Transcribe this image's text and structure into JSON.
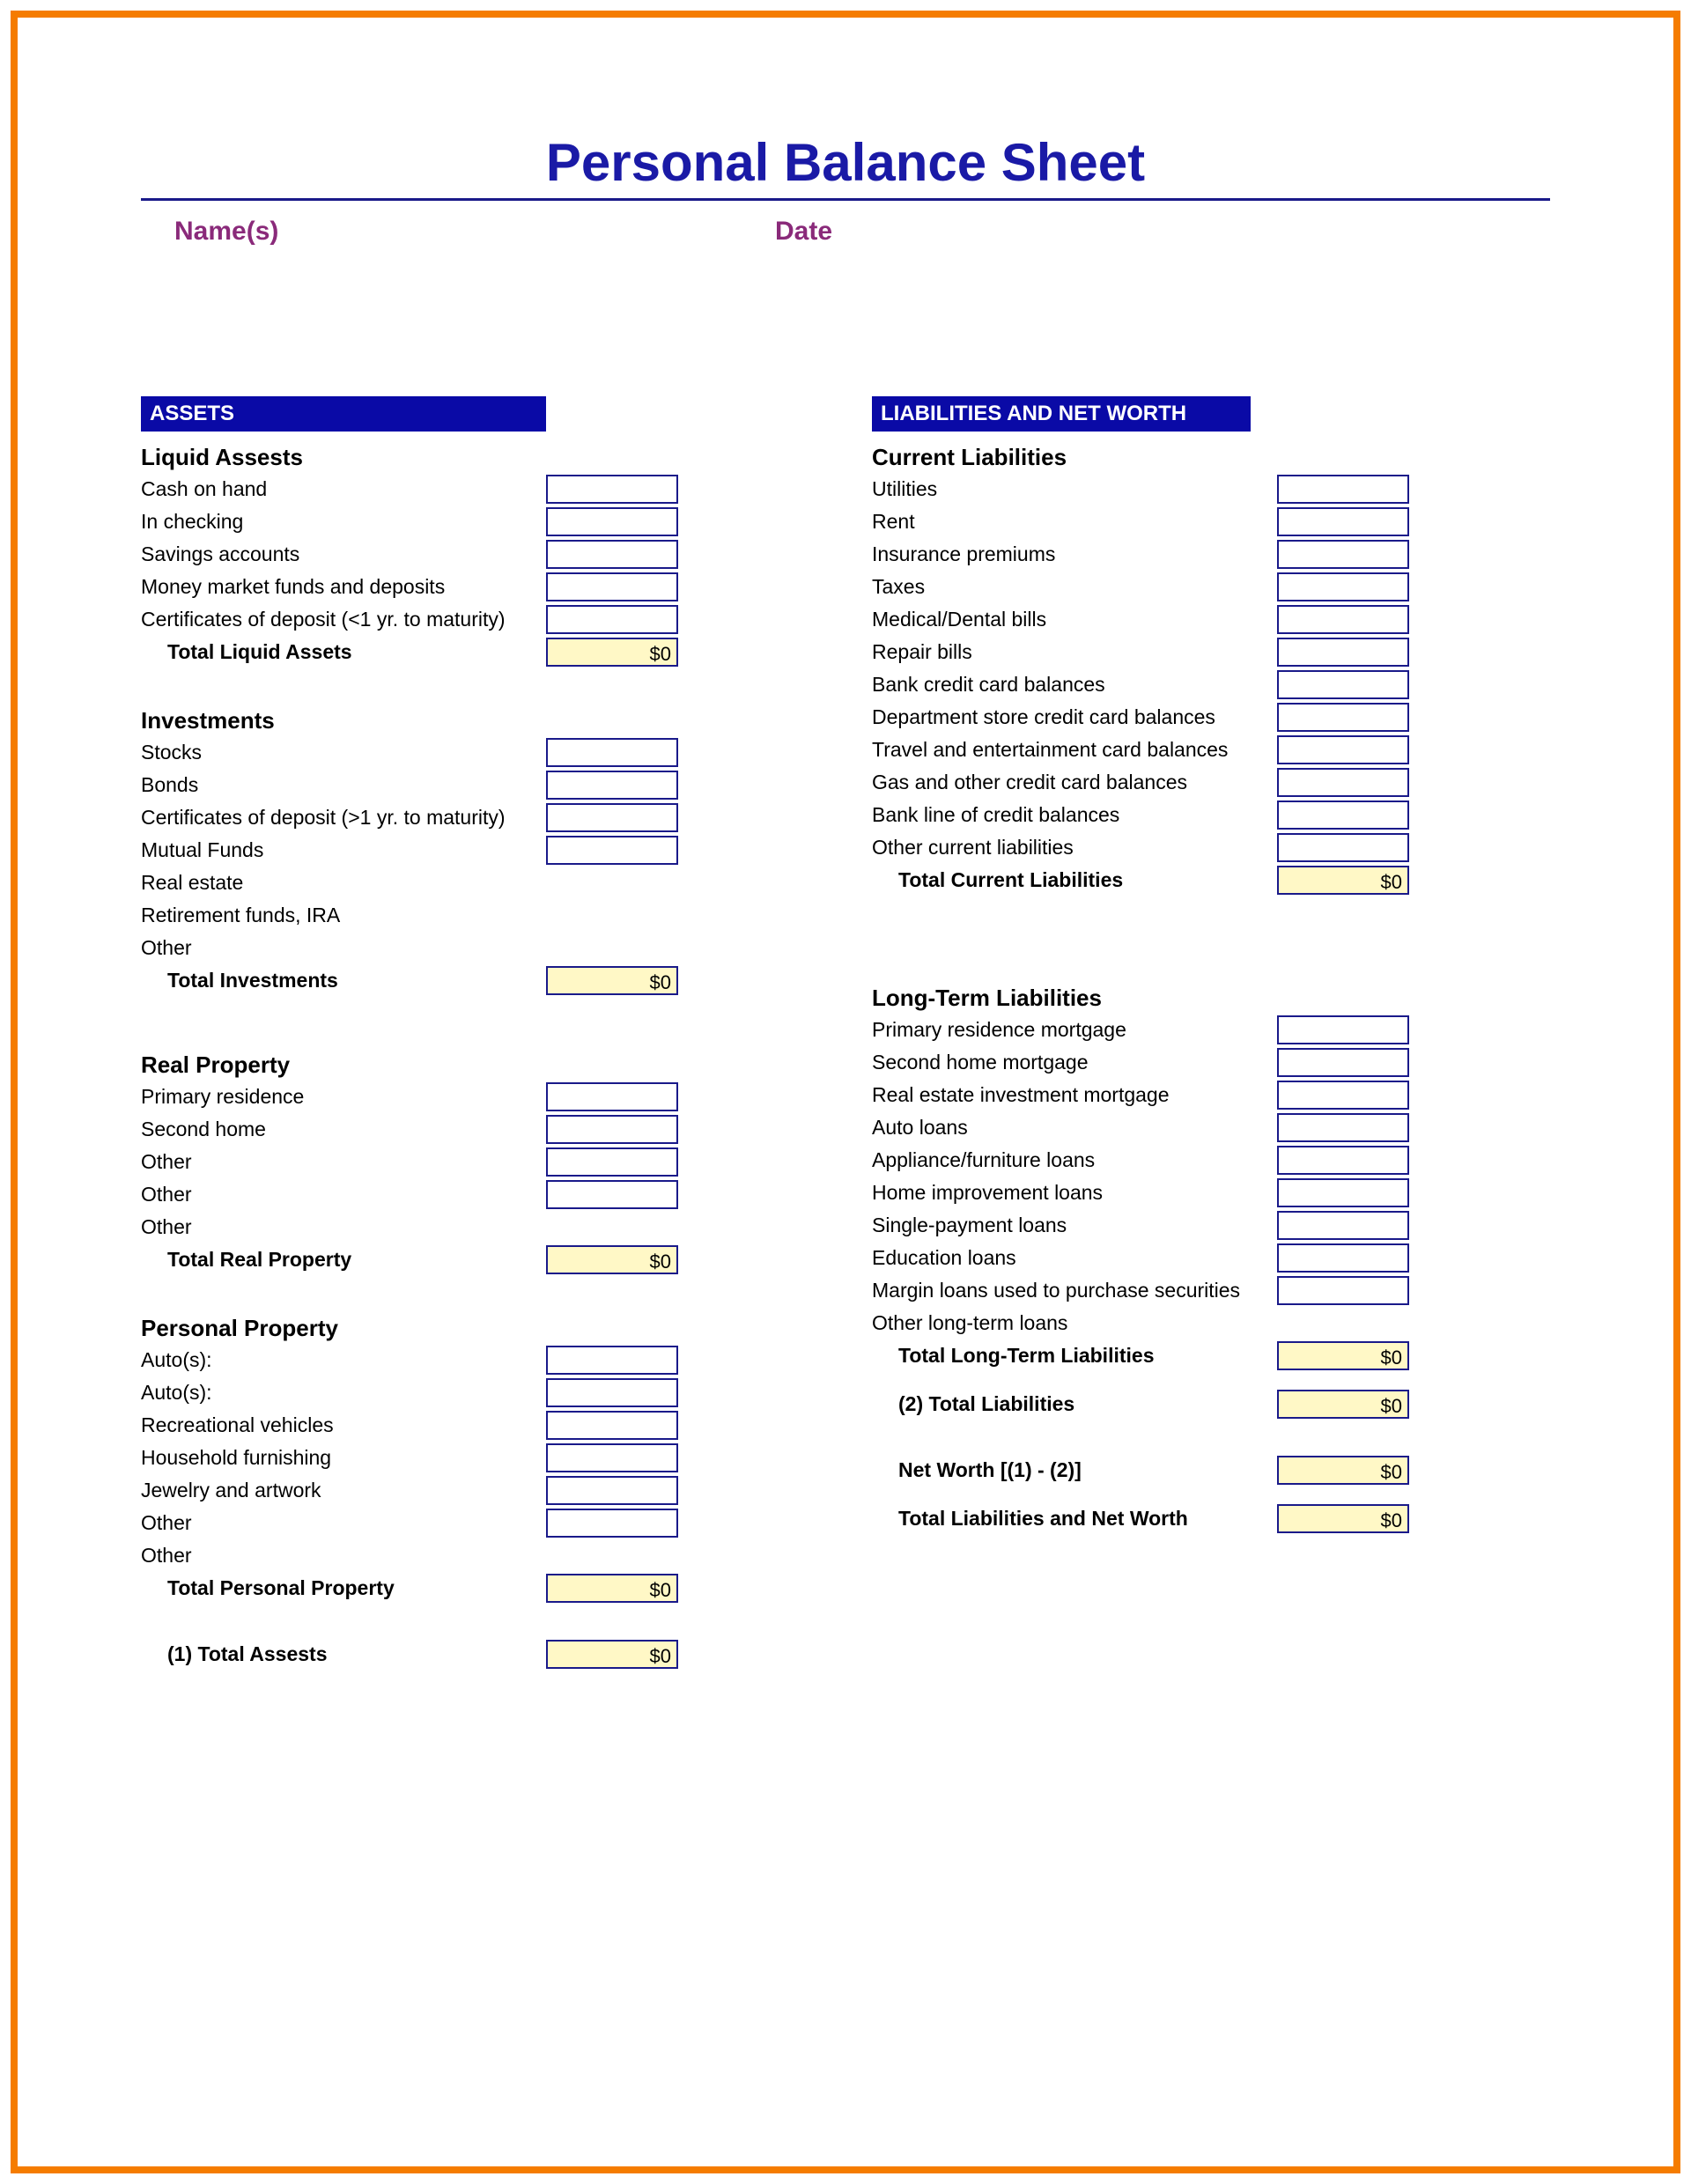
{
  "title": "Personal Balance Sheet",
  "meta": {
    "names_label": "Name(s)",
    "date_label": "Date"
  },
  "left": {
    "bar": "ASSETS",
    "liquid": {
      "title": "Liquid Assests",
      "items": [
        "Cash on hand",
        "In checking",
        "Savings accounts",
        "Money market funds and deposits",
        "Certificates of deposit (<1 yr. to maturity)"
      ],
      "total_label": "Total Liquid Assets",
      "total_value": "$0"
    },
    "investments": {
      "title": "Investments",
      "items": [
        "Stocks",
        "Bonds",
        "Certificates of deposit (>1 yr. to maturity)",
        "Mutual Funds",
        "Real estate",
        "Retirement funds, IRA",
        "Other"
      ],
      "cell_count": 4,
      "total_label": "Total Investments",
      "total_value": "$0"
    },
    "real_property": {
      "title": "Real Property",
      "items": [
        "Primary residence",
        "Second home",
        "Other",
        "Other",
        "Other"
      ],
      "cell_count": 4,
      "total_label": "Total Real Property",
      "total_value": "$0"
    },
    "personal_property": {
      "title": "Personal Property",
      "items": [
        "Auto(s):",
        "Auto(s):",
        "Recreational vehicles",
        "Household furnishing",
        "Jewelry and artwork",
        "Other",
        "Other"
      ],
      "cell_count": 6,
      "total_label": "Total Personal Property",
      "total_value": "$0"
    },
    "grand_total_label": "(1) Total Assests",
    "grand_total_value": "$0"
  },
  "right": {
    "bar": "LIABILITIES AND NET WORTH",
    "current": {
      "title": "Current Liabilities",
      "items": [
        "Utilities",
        "Rent",
        "Insurance premiums",
        "Taxes",
        "Medical/Dental bills",
        "Repair bills",
        "Bank credit card balances",
        "Department store credit card balances",
        "Travel and entertainment card balances",
        "Gas and other credit card balances",
        "Bank line of credit balances",
        "Other current liabilities"
      ],
      "total_label": "Total Current Liabilities",
      "total_value": "$0"
    },
    "long_term": {
      "title": "Long-Term Liabilities",
      "items": [
        "Primary residence mortgage",
        "Second home mortgage",
        "Real estate investment mortgage",
        "Auto loans",
        "Appliance/furniture loans",
        "Home improvement loans",
        "Single-payment loans",
        "Education loans",
        "Margin loans used to purchase securities",
        "Other long-term loans"
      ],
      "cell_count": 9,
      "total_label": "Total Long-Term Liabilities",
      "total_value": "$0"
    },
    "total_liab_label": "(2) Total Liabilities",
    "total_liab_value": "$0",
    "net_worth_label": "Net Worth [(1) - (2)]",
    "net_worth_value": "$0",
    "grand_total_label": "Total Liabilities and Net Worth",
    "grand_total_value": "$0"
  }
}
